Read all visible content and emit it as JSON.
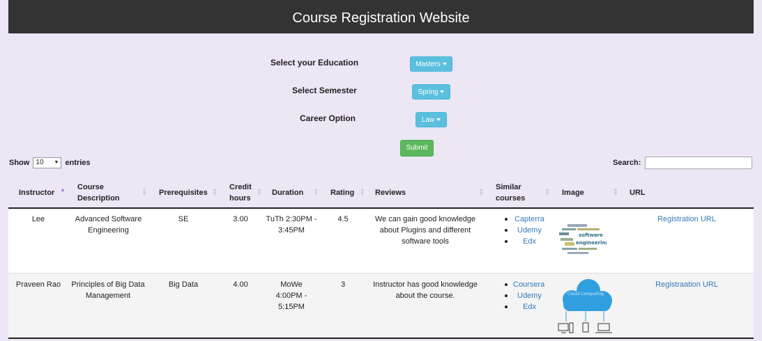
{
  "header": {
    "title": "Course Registration Website"
  },
  "form": {
    "education": {
      "label": "Select your Education",
      "value": "Masters"
    },
    "semester": {
      "label": "Select Semester",
      "value": "Spring"
    },
    "career": {
      "label": "Career Option",
      "value": "Law"
    },
    "submit_label": "Submit"
  },
  "table_controls": {
    "show_label": "Show",
    "entries_value": "10",
    "entries_label": "entries",
    "search_label": "Search:"
  },
  "columns": {
    "instructor": "Instructor",
    "course_description": "Course Description",
    "prerequisites": "Prerequisites",
    "credit_hours": "Credit hours",
    "duration": "Duration",
    "rating": "Rating",
    "reviews": "Reviews",
    "similar_courses": "Similar courses",
    "image": "Image",
    "url": "URL"
  },
  "rows": [
    {
      "instructor": "Lee",
      "course_description": "Advanced Software Engineering",
      "prerequisites": "SE",
      "credit_hours": "3.00",
      "duration": "TuTh 2:30PM - 3:45PM",
      "rating": "4.5",
      "reviews": "We can gain good knowledge about Plugins and different software tools",
      "similar_courses": [
        "Capterra",
        "Udemy",
        "Edx"
      ],
      "image_icon": "software-engineering-word-cloud",
      "url_label": "Registration URL"
    },
    {
      "instructor": "Praveen Rao",
      "course_description": "Principles of Big Data Management",
      "prerequisites": "Big Data",
      "credit_hours": "4.00",
      "duration": "MoWe 4:00PM - 5:15PM",
      "rating": "3",
      "reviews": "Instructor has good knowledge about the course.",
      "similar_courses": [
        "Coursera",
        "Udemy",
        "Edx"
      ],
      "image_icon": "cloud-computing-diagram",
      "image_text": "Cloud Computing",
      "url_label": "Registraation URL"
    }
  ],
  "colors": {
    "header_bg": "#333333",
    "page_bg": "#ece6f5",
    "dropdown": "#5bc0de",
    "submit": "#5cb85c",
    "link": "#337ab7",
    "cloud": "#2f9fe0"
  }
}
